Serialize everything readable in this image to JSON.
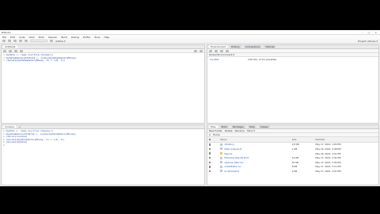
{
  "window": {
    "title": "RStudio",
    "controls": [
      "–",
      "□",
      "×"
    ]
  },
  "menu": [
    "File",
    "Edit",
    "Code",
    "View",
    "Plots",
    "Session",
    "Build",
    "Debug",
    "Profile",
    "Tools",
    "Help"
  ],
  "toolbar": {
    "goto_placeholder": "Go to file/function",
    "addins": "Addins ▾",
    "project": "Project: (None) ▾"
  },
  "editor": {
    "tab": "Untitled1",
    "lines": [
      "mydata <- read.csv(file.choose())",
      "mydata$SalaryStdArea <- scale(mydata$SalaryMoney)",
      "rescale(mydata$SalaryMoney, to = c(0, 1))"
    ]
  },
  "console": {
    "tab": "Console",
    "path": "~/",
    "lines": [
      "> mydata <- read.csv(file.choose())",
      "> mydata$SalaryStdArea <- scale(mydata$SalaryMoney)",
      "> library(scales)",
      "> rescale(mydata$SalaryMoney, to = c(0, 1))",
      "> rescale(mydata)",
      ">"
    ]
  },
  "environment": {
    "tabs": [
      "Environment",
      "History",
      "Connections",
      "Tutorial"
    ],
    "scope": "Global Environment ▾",
    "row": {
      "name": "mydata",
      "value": "100 obs. of 15 variables"
    }
  },
  "files": {
    "tabs": [
      "Files",
      "Plots",
      "Packages",
      "Help",
      "Viewer"
    ],
    "actions": [
      "New Folder",
      "Delete",
      "Rename",
      "More ▾"
    ],
    "path": "Home",
    "columns": [
      "Name",
      "Size",
      "Modified"
    ],
    "rows": [
      {
        "name": ".Rhistory",
        "size": "2.8 KB",
        "modified": "May 17, 2021, 1:05 PM"
      },
      {
        "name": "Data Analysis.R",
        "size": "1 KB",
        "modified": "May 16, 2021, 3:48 PM"
      },
      {
        "name": "Figures",
        "size": "",
        "modified": "May 16, 2021, 3:51 PM"
      },
      {
        "name": "Modeling Results.Rmd",
        "size": "14 KB",
        "modified": "May 17, 2021, 2:41 PM"
      },
      {
        "name": "salaries_data.csv",
        "size": "22 KB",
        "modified": "May 17, 2021, 3:05 PM"
      },
      {
        "name": "scaledData.csv",
        "size": "8 KB",
        "modified": "May 17, 2021, 3:11 PM"
      },
      {
        "name": "Scratchpad.R",
        "size": "2 KB",
        "modified": "May 17, 2021, 3:07 PM"
      }
    ]
  }
}
